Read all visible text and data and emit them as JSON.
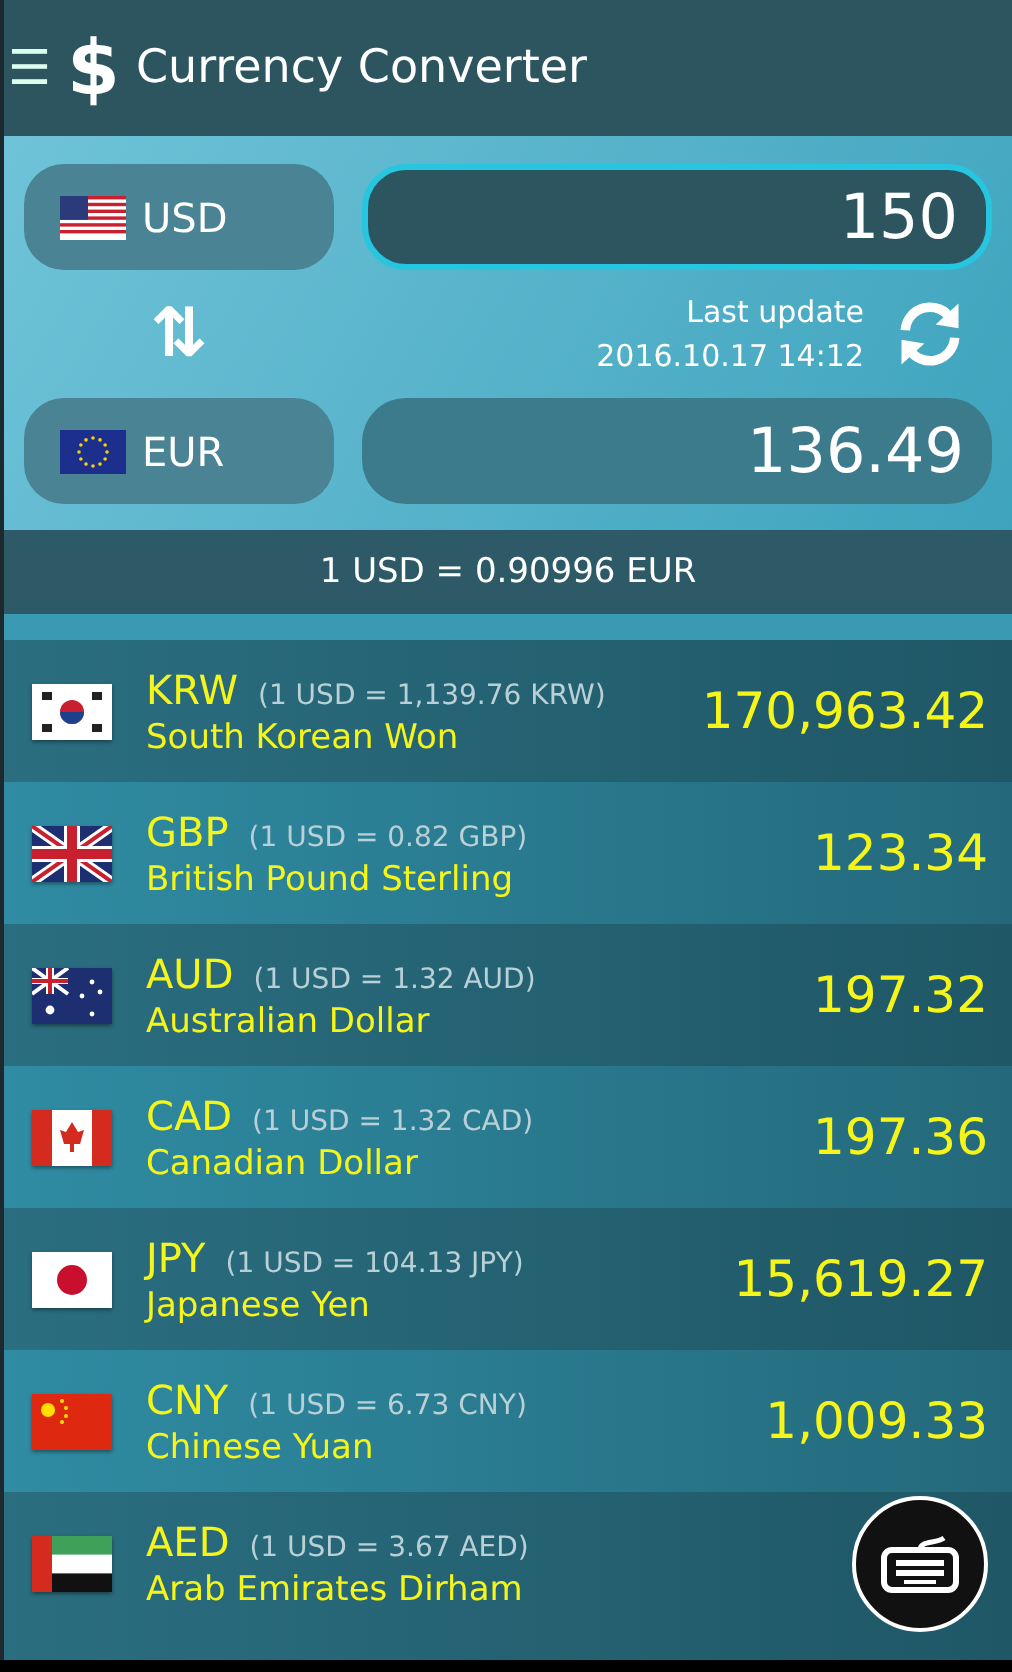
{
  "app_bar": {
    "menu": "☰",
    "logo": "$",
    "title": "Currency Converter"
  },
  "converter": {
    "from": {
      "code": "USD",
      "amount": "150"
    },
    "swap": "⇅",
    "to": {
      "code": "EUR",
      "amount": "136.49"
    },
    "last_update_label": "Last update",
    "last_update_time": "2016.10.17 14:12"
  },
  "rate": "1 USD = 0.90996 EUR",
  "rows": [
    {
      "code": "KRW",
      "rate": "(1 USD = 1,139.76 KRW)",
      "name": "South Korean Won",
      "value": "170,963.42"
    },
    {
      "code": "GBP",
      "rate": "(1 USD = 0.82 GBP)",
      "name": "British Pound Sterling",
      "value": "123.34"
    },
    {
      "code": "AUD",
      "rate": "(1 USD = 1.32 AUD)",
      "name": "Australian Dollar",
      "value": "197.32"
    },
    {
      "code": "CAD",
      "rate": "(1 USD = 1.32 CAD)",
      "name": "Canadian Dollar",
      "value": "197.36"
    },
    {
      "code": "JPY",
      "rate": "(1 USD = 104.13 JPY)",
      "name": "Japanese Yen",
      "value": "15,619.27"
    },
    {
      "code": "CNY",
      "rate": "(1 USD = 6.73 CNY)",
      "name": "Chinese Yuan",
      "value": "1,009.33"
    },
    {
      "code": "AED",
      "rate": "(1 USD = 3.67 AED)",
      "name": "Arab Emirates Dirham"
    }
  ]
}
